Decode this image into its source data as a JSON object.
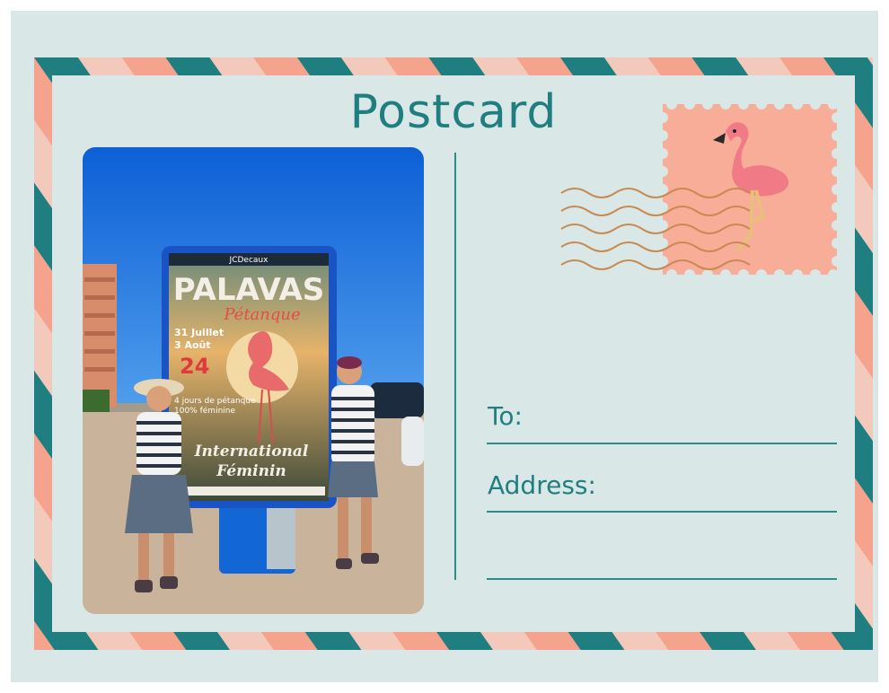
{
  "postcard": {
    "title": "Postcard",
    "to_label": "To:",
    "address_label": "Address:"
  },
  "photo": {
    "poster": {
      "brand": "JCDecaux",
      "headline": "PALAVAS",
      "script": "Pétanque",
      "date_line_1": "31 Juillet",
      "date_line_2": "3 Août",
      "year": "24",
      "info_line_1": "4 jours de pétanque",
      "info_line_2": "100% féminine",
      "footer_line_1": "International",
      "footer_line_2": "Féminin"
    }
  },
  "colors": {
    "teal": "#1f7f80",
    "salmon": "#f5a38c",
    "stripe_blush": "#f2c9bb",
    "background": "#d9e7e6"
  },
  "icons": [
    "flamingo-stamp-icon",
    "postmark-wave-icon"
  ]
}
